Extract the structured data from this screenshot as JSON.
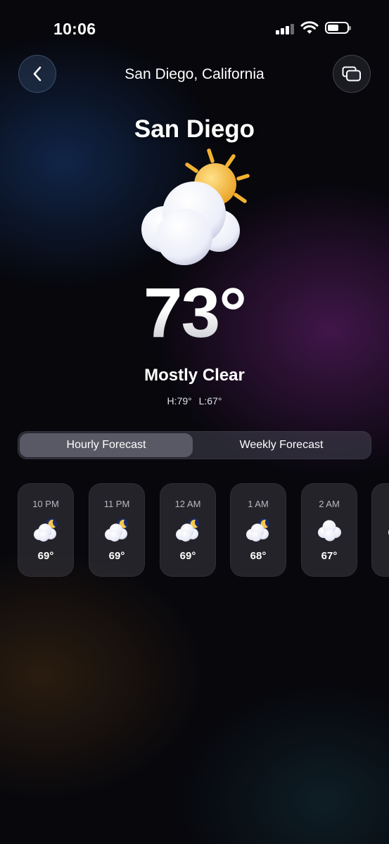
{
  "status_bar": {
    "time": "10:06"
  },
  "header": {
    "title": "San Diego, California",
    "back_icon": "chevron-left-icon",
    "menu_icon": "windows-icon"
  },
  "current": {
    "city": "San Diego",
    "icon": "partly-cloudy-sun-icon",
    "temperature": "73°",
    "condition": "Mostly Clear",
    "high": "H:79°",
    "low": "L:67°"
  },
  "tabs": [
    {
      "label": "Hourly Forecast",
      "active": true
    },
    {
      "label": "Weekly Forecast",
      "active": false
    }
  ],
  "hourly": [
    {
      "time": "10 PM",
      "temp": "69°",
      "icon": "cloudy-night-icon"
    },
    {
      "time": "11 PM",
      "temp": "69°",
      "icon": "cloudy-night-icon"
    },
    {
      "time": "12 AM",
      "temp": "69°",
      "icon": "cloudy-night-icon"
    },
    {
      "time": "1 AM",
      "temp": "68°",
      "icon": "cloudy-night-icon"
    },
    {
      "time": "2 AM",
      "temp": "67°",
      "icon": "cloudy-icon"
    },
    {
      "time": "",
      "temp": "",
      "icon": "cloudy-icon"
    }
  ],
  "colors": {
    "sun": "#f4b53c",
    "cloud": "#eef0f8",
    "moon": "#1c2a6a"
  }
}
